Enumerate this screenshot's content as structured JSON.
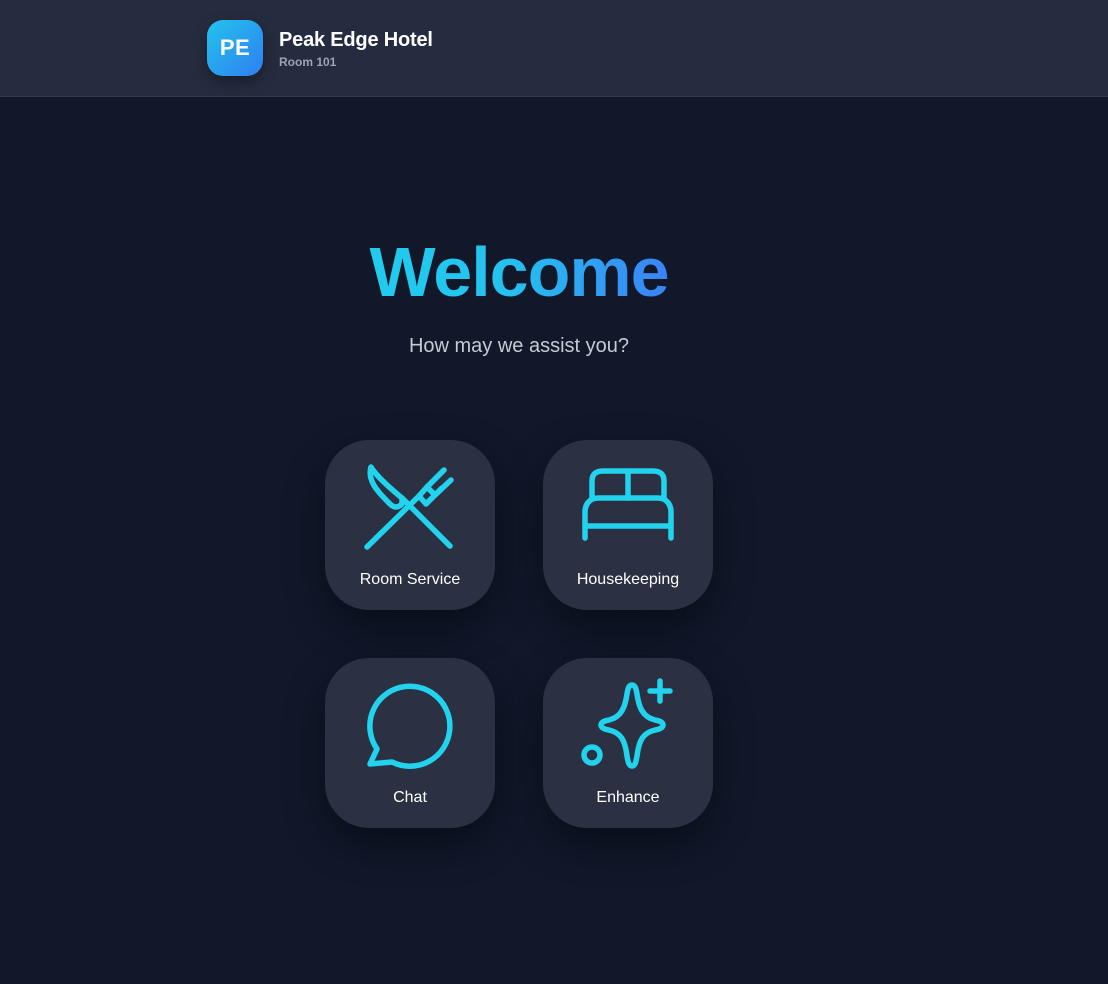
{
  "header": {
    "logo_text": "PE",
    "hotel_name": "Peak Edge Hotel",
    "room": "Room 101"
  },
  "hero": {
    "title": "Welcome",
    "subtitle": "How may we assist you?"
  },
  "services": [
    {
      "label": "Room Service",
      "icon": "utensils-crossed-icon"
    },
    {
      "label": "Housekeeping",
      "icon": "bed-icon"
    },
    {
      "label": "Chat",
      "icon": "chat-bubble-icon"
    },
    {
      "label": "Enhance",
      "icon": "sparkles-icon"
    }
  ],
  "colors": {
    "background": "#10182a",
    "header": "#262c3f",
    "tile": "#2b3143",
    "accent": "#22d3ee",
    "gradient_end": "#3b82f6"
  }
}
